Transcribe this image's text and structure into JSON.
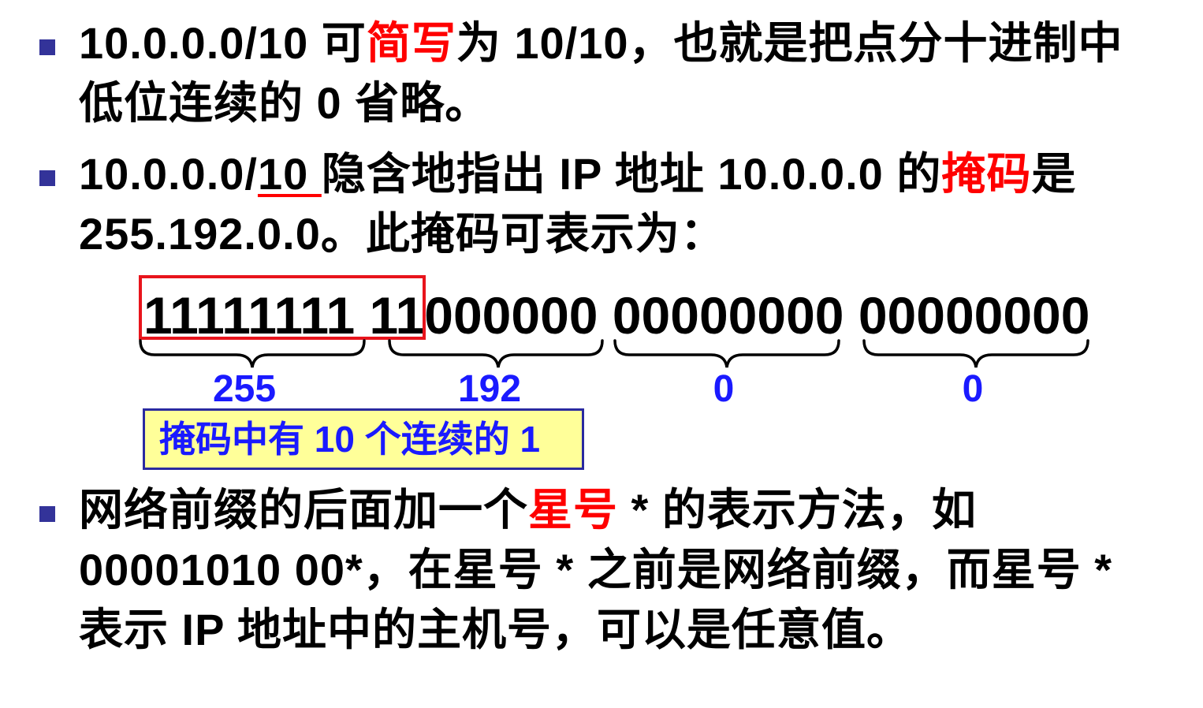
{
  "bullet1": {
    "l1_a": "10.0.0.0/10  可",
    "l1_red": "简写",
    "l1_b": "为  10/10，也就是把点分十进制中",
    "l2": "低位连续的 0 省略。"
  },
  "bullet2": {
    "l1_a": "10.0.0.0/",
    "l1_ul": "10 ",
    "l1_b": " 隐含地指出  IP  地址  10.0.0.0  的",
    "l1_red": "掩码",
    "l1_c": "是",
    "l2": "255.192.0.0。此掩码可表示为："
  },
  "binary": "11111111 11000000 00000000 00000000",
  "octets": [
    "255",
    "192",
    "0",
    "0"
  ],
  "note": "掩码中有 10 个连续的 1",
  "bullet3": {
    "l1_a": "网络前缀的后面加一个",
    "l1_red": "星号",
    "l1_b": " * 的表示方法，如",
    "l2": "00001010 00*，在星号 * 之前是网络前缀，而星号 *",
    "l3": "表示 IP 地址中的主机号，可以是任意值。"
  },
  "colors": {
    "bullet": "#333399",
    "highlight": "#ff0000",
    "octet": "#1a1aff",
    "note_bg": "#ffff99"
  }
}
